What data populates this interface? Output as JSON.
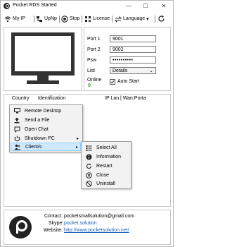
{
  "window": {
    "title": "Pocket RDS Started",
    "minimize": "—",
    "maximize": "☐",
    "close": "✕"
  },
  "toolbar": {
    "my_ip": "My IP",
    "upnp": "UpNp",
    "stop": "Stop",
    "license": "License",
    "language": "Language",
    "language_arrow": "▾"
  },
  "settings": {
    "port1_label": "Port 1",
    "port1_value": "9001",
    "port2_label": "Port 2",
    "port2_value": "9002",
    "psw_label": "Psw",
    "psw_value": "••••••••••",
    "list_label": "List",
    "list_value": "Details",
    "online_label": "Online",
    "online_count": "0",
    "autostart_label": "Auto Start",
    "autostart_checked": true
  },
  "table": {
    "columns": [
      "Country",
      "Identification",
      "IP Lan | Wan:Porta"
    ]
  },
  "context_menu": {
    "items": [
      {
        "label": "Remote Desktop",
        "icon": "monitor-icon"
      },
      {
        "label": "Send a File",
        "icon": "upload-file-icon"
      },
      {
        "label": "Open Chat",
        "icon": "chat-icon"
      },
      {
        "label": "Shutdown PC",
        "icon": "shutdown-icon",
        "submenu": true
      },
      {
        "label": "Client/s",
        "icon": "users-icon",
        "submenu": true,
        "highlighted": true
      }
    ],
    "submenu_arrow": "▸"
  },
  "submenu": {
    "items": [
      {
        "label": "Select All",
        "icon": "list-icon"
      },
      {
        "label": "Information",
        "icon": "info-icon"
      },
      {
        "label": "Restart",
        "icon": "restart-icon"
      },
      {
        "label": "Close",
        "icon": "close-circle-icon"
      },
      {
        "label": "Uninstall",
        "icon": "uninstall-icon"
      }
    ]
  },
  "footer": {
    "contact_label": "Contact:",
    "contact_value": "pocketsmallsolution@gmail.com",
    "skype_label": "Skype:",
    "skype_value": "pocket.solution",
    "website_label": "Website:",
    "website_value": "http://www.pocketsolution.net/"
  },
  "colors": {
    "accent": "#1a5fb4",
    "monitor": "#333333",
    "online_green": "#2e9b2e",
    "menu_highlight": "#cde8ff"
  }
}
